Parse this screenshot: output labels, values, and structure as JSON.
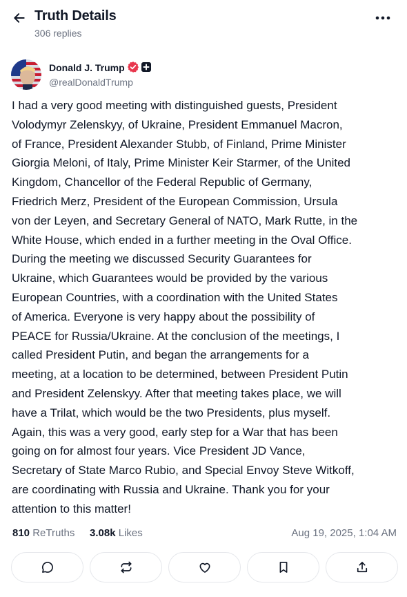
{
  "header": {
    "title": "Truth Details",
    "replies": "306 replies"
  },
  "author": {
    "name": "Donald J. Trump",
    "handle": "@realDonaldTrump"
  },
  "post": {
    "lines": [
      "I had a very good meeting with distinguished guests, President",
      "Volodymyr Zelenskyy, of Ukraine, President Emmanuel Macron,",
      "of France, President Alexander Stubb, of Finland, Prime Minister",
      "Giorgia Meloni, of Italy, Prime Minister Keir Starmer, of the United",
      "Kingdom, Chancellor of the Federal Republic of Germany,",
      "Friedrich Merz, President of the European Commission, Ursula",
      "von der Leyen, and Secretary General of NATO, Mark Rutte, in the",
      "White House, which ended in a further meeting in the Oval Office.",
      "During the meeting we discussed Security Guarantees for",
      "Ukraine, which Guarantees would be provided by the various",
      "European Countries, with a coordination with the United States",
      "of America. Everyone is very happy about the possibility of",
      "PEACE for Russia/Ukraine. At the conclusion of the meetings, I",
      "called President Putin, and began the arrangements for a",
      "meeting, at a location to be determined, between President Putin",
      "and President Zelenskyy. After that meeting takes place, we will",
      "have a Trilat, which would be the two Presidents, plus myself.",
      "Again, this was a very good, early step for a War that has been",
      "going on for almost four years. Vice President JD Vance,",
      "Secretary of State Marco Rubio, and Special Envoy Steve Witkoff,",
      "are coordinating with Russia and Ukraine. Thank you for your",
      "attention to this matter!"
    ]
  },
  "stats": {
    "retruths_count": "810",
    "retruths_label": "ReTruths",
    "likes_count": "3.08k",
    "likes_label": "Likes",
    "timestamp": "Aug 19, 2025, 1:04 AM"
  },
  "actions": [
    {
      "icon": "reply-icon"
    },
    {
      "icon": "retruth-icon"
    },
    {
      "icon": "heart-icon"
    },
    {
      "icon": "bookmark-icon"
    },
    {
      "icon": "share-icon"
    }
  ],
  "colors": {
    "text": "#111827",
    "muted": "#6b7280",
    "border": "#e5e7eb",
    "verified": "#e8374e"
  }
}
